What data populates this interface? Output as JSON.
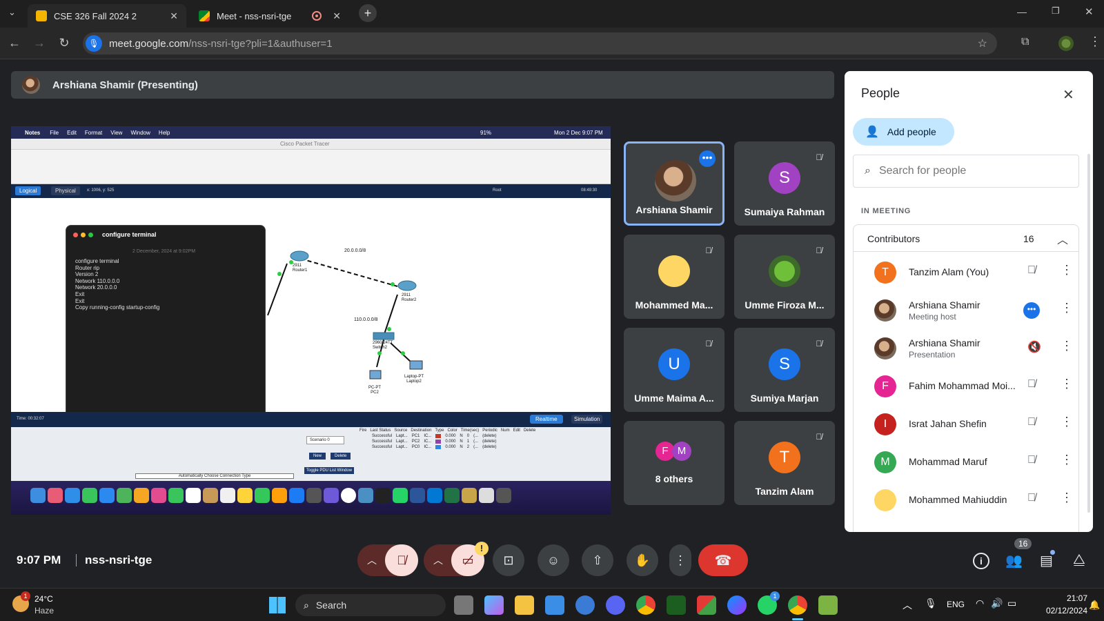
{
  "browser": {
    "tabs": [
      {
        "title": "CSE 326 Fall 2024 2",
        "active": true
      },
      {
        "title": "Meet - nss-nsri-tge",
        "active": false
      }
    ],
    "url_host": "meet.google.com",
    "url_path": "/nss-nsri-tge?pli=1&authuser=1"
  },
  "presenter": {
    "label": "Arshiana Shamir (Presenting)"
  },
  "shared_screen": {
    "menu": [
      "Notes",
      "File",
      "Edit",
      "Format",
      "View",
      "Window",
      "Help"
    ],
    "menu_status_battery": "91%",
    "menu_status_datetime": "Mon 2 Dec  9:07 PM",
    "app_title": "Cisco Packet Tracer",
    "mode_logical": "Logical",
    "mode_physical": "Physical",
    "coords": "x: 1006, y: 525",
    "root_label": "Root",
    "clock": "08:49:30",
    "notes_title": "configure terminal",
    "notes_date": "2 December, 2024 at 9:02PM",
    "notes_lines": [
      "configure terminal",
      "Router rip",
      "Version 2",
      "Network 110.0.0.0",
      "Network 20.0.0.0",
      "Exit",
      "Exit",
      "Copy running-config startup-config"
    ],
    "network_labels": {
      "net_top": "20.0.0.0/8",
      "net_mid": "110.0.0.0/8",
      "router1": "2911\nRouter1",
      "router2": "2911\nRouter2",
      "switch": "2960-24TT\nSwitch2",
      "pc": "PC-PT\nPC2",
      "laptop": "Laptop-PT\nLaptop2"
    },
    "time_label": "Time: 00:32:07",
    "realtime": "Realtime",
    "simulation": "Simulation",
    "scenario": "Scenario 0",
    "new_btn": "New",
    "delete_btn": "Delete",
    "toggle_pdu": "Toggle PDU List Window",
    "auto_conn": "Automatically Choose Connection Type",
    "pdu_headers": [
      "Fire",
      "Last Status",
      "Source",
      "Destination",
      "Type",
      "Color",
      "Time(sec)",
      "Periodic",
      "Num",
      "Edit",
      "Delete"
    ],
    "pdu_rows": [
      {
        "status": "Successful",
        "src": "Lapt...",
        "dst": "PC1",
        "type": "IC...",
        "color": "#c0392b",
        "time": "0.000",
        "periodic": "N",
        "num": "0",
        "edit": "(...",
        "del": "(delete)"
      },
      {
        "status": "Successful",
        "src": "Lapt...",
        "dst": "PC2",
        "type": "IC...",
        "color": "#8e44ad",
        "time": "0.000",
        "periodic": "N",
        "num": "1",
        "edit": "(...",
        "del": "(delete)"
      },
      {
        "status": "Successful",
        "src": "Lapt...",
        "dst": "PC0",
        "type": "IC...",
        "color": "#2e86de",
        "time": "0.000",
        "periodic": "N",
        "num": "2",
        "edit": "(...",
        "del": "(delete)"
      }
    ]
  },
  "tiles": [
    {
      "name": "Arshiana Shamir",
      "kind": "photo",
      "speaking": true
    },
    {
      "name": "Sumaiya Rahman",
      "letter": "S",
      "color": "#a142c2",
      "muted": true
    },
    {
      "name": "Mohammed Ma...",
      "kind": "avatar-yellow",
      "muted": true
    },
    {
      "name": "Umme Firoza M...",
      "kind": "avatar-frog",
      "muted": true
    },
    {
      "name": "Umme Maima A...",
      "letter": "U",
      "color": "#1a73e8",
      "muted": true
    },
    {
      "name": "Sumiya Marjan",
      "letter": "S",
      "color": "#1a73e8",
      "muted": true
    },
    {
      "name": "8 others",
      "letters": [
        "F",
        "M"
      ]
    },
    {
      "name": "Tanzim Alam",
      "letter": "T",
      "color": "#f2711c",
      "muted": true
    }
  ],
  "people_panel": {
    "title": "People",
    "add_people": "Add people",
    "search_placeholder": "Search for people",
    "section": "IN MEETING",
    "group": "Contributors",
    "count": "16",
    "members": [
      {
        "name": "Tanzim Alam (You)",
        "letter": "T",
        "color": "#f2711c",
        "sub": ""
      },
      {
        "name": "Arshiana Shamir",
        "sub": "Meeting host",
        "photo": true,
        "more_active": true
      },
      {
        "name": "Arshiana Shamir",
        "sub": "Presentation",
        "photo": true
      },
      {
        "name": "Fahim Mohammad Moi...",
        "letter": "F",
        "color": "#e52592",
        "sub": ""
      },
      {
        "name": "Israt Jahan Shefin",
        "letter": "I",
        "color": "#c5221f",
        "sub": ""
      },
      {
        "name": "Mohammad Maruf",
        "letter": "M",
        "color": "#34a853",
        "sub": ""
      },
      {
        "name": "Mohammed Mahiuddin",
        "avatar": true,
        "sub": ""
      }
    ]
  },
  "bottom": {
    "time": "9:07 PM",
    "meeting_code": "nss-nsri-tge",
    "people_badge": "16"
  },
  "taskbar": {
    "weather_temp": "24°C",
    "weather_desc": "Haze",
    "weather_badge": "1",
    "search": "Search",
    "lang": "ENG",
    "time": "21:07",
    "date": "02/12/2024",
    "whatsapp_badge": "1"
  }
}
